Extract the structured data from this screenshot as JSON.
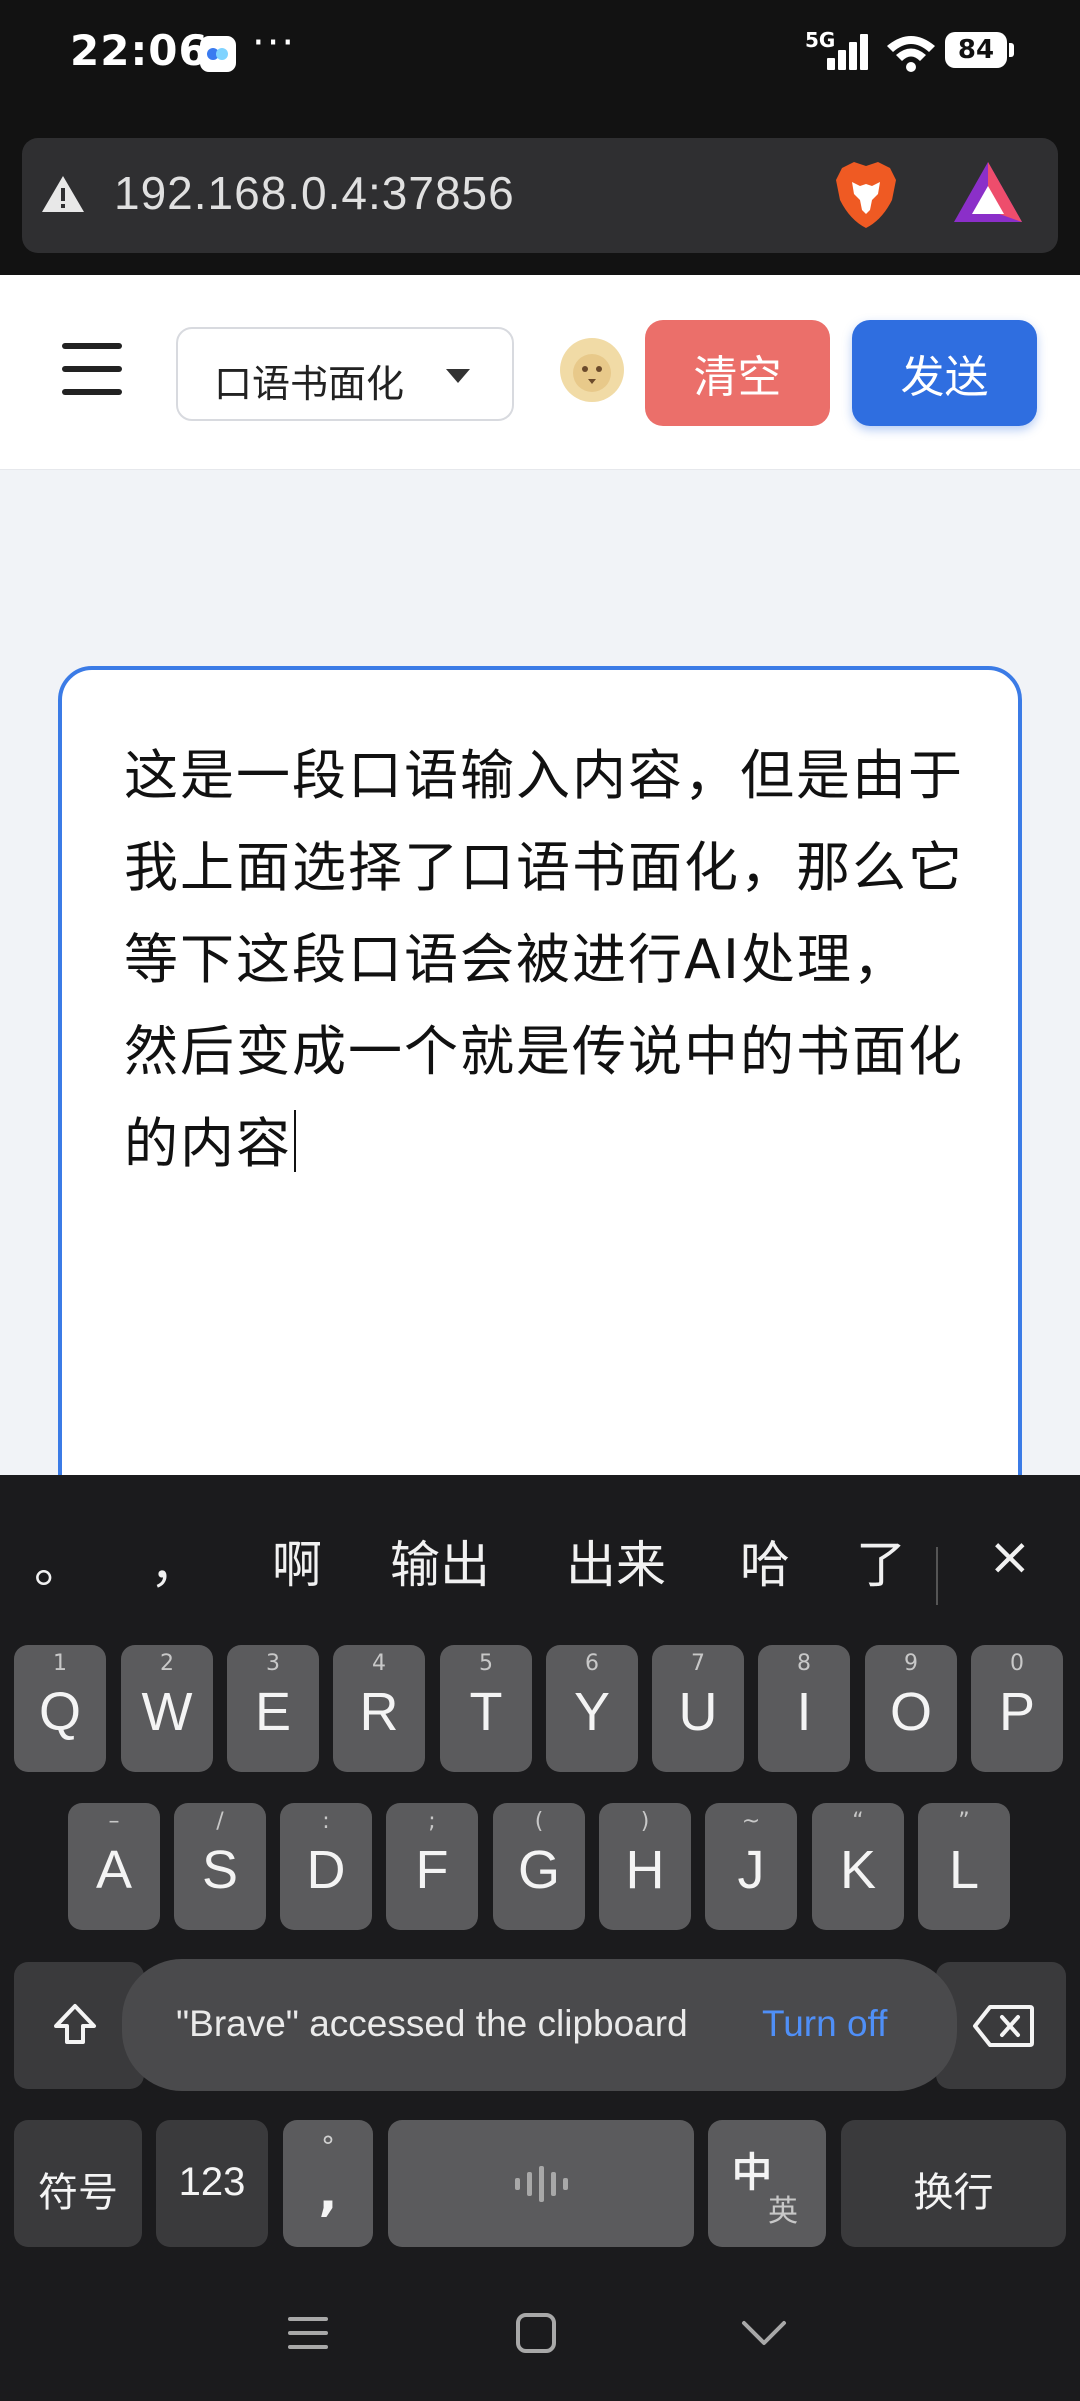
{
  "status_bar": {
    "time": "22:06",
    "dots": "···",
    "network": "5G",
    "battery": "84"
  },
  "browser": {
    "url": "192.168.0.4:37856"
  },
  "header": {
    "mode_select": "口语书面化",
    "clear_label": "清空",
    "send_label": "发送"
  },
  "editor": {
    "text": "这是一段口语输入内容，但是由于我上面选择了口语书面化，那么它等下这段口语会被进行AI处理，然后变成一个就是传说中的书面化的内容"
  },
  "keyboard": {
    "candidates": [
      "。",
      "，",
      "啊",
      "输出",
      "出来",
      "哈",
      "了"
    ],
    "close": "×",
    "row1": [
      {
        "letter": "Q",
        "hint": "1"
      },
      {
        "letter": "W",
        "hint": "2"
      },
      {
        "letter": "E",
        "hint": "3"
      },
      {
        "letter": "R",
        "hint": "4"
      },
      {
        "letter": "T",
        "hint": "5"
      },
      {
        "letter": "Y",
        "hint": "6"
      },
      {
        "letter": "U",
        "hint": "7"
      },
      {
        "letter": "I",
        "hint": "8"
      },
      {
        "letter": "O",
        "hint": "9"
      },
      {
        "letter": "P",
        "hint": "0"
      }
    ],
    "row2": [
      {
        "letter": "A",
        "hint": "–"
      },
      {
        "letter": "S",
        "hint": "/"
      },
      {
        "letter": "D",
        "hint": ":"
      },
      {
        "letter": "F",
        "hint": ";"
      },
      {
        "letter": "G",
        "hint": "("
      },
      {
        "letter": "H",
        "hint": ")"
      },
      {
        "letter": "J",
        "hint": "~"
      },
      {
        "letter": "K",
        "hint": "“"
      },
      {
        "letter": "L",
        "hint": "”"
      }
    ],
    "symbols_label": "符号",
    "numbers_label": "123",
    "punct_top": "°",
    "punct_bottom": ",",
    "lang_main": "中",
    "lang_alt": "英",
    "enter_label": "换行"
  },
  "toast": {
    "message": "\"Brave\" accessed the clipboard",
    "action": "Turn off"
  },
  "colors": {
    "clear_button": "#eb6f6a",
    "send_button": "#2f6ee0",
    "editor_border": "#3b7be6",
    "toast_action": "#4f8ff7"
  }
}
